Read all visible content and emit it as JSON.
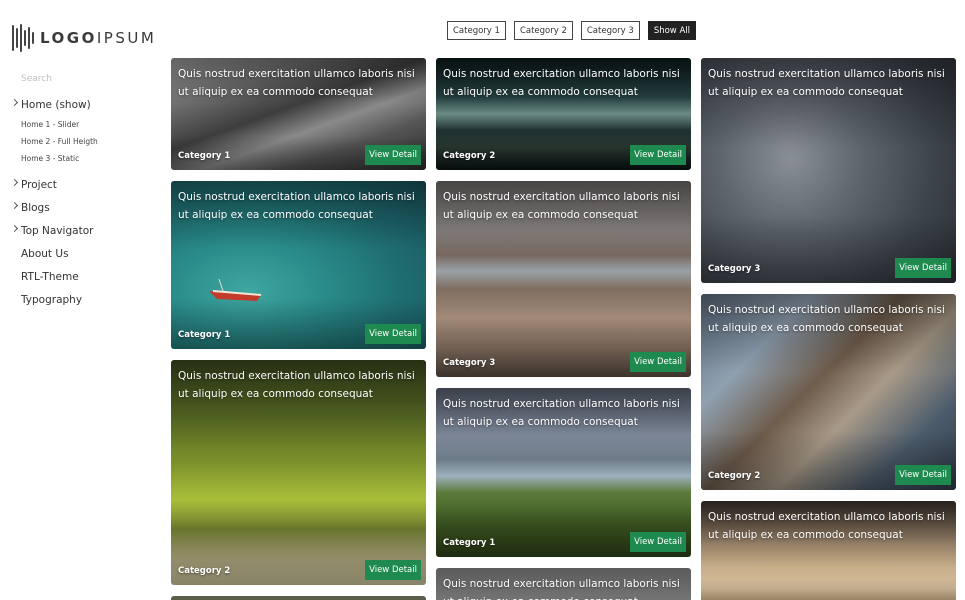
{
  "logo": {
    "bold": "LOGO",
    "light": "IPSUM"
  },
  "search": {
    "placeholder": "Search"
  },
  "nav": {
    "home": "Home (show)",
    "home1": "Home 1 - Slider",
    "home2": "Home 2 - Full Heigth",
    "home3": "Home 3 - Static",
    "project": "Project",
    "blogs": "Blogs",
    "topnav": "Top Navigator",
    "about": "About Us",
    "rtl": "RTL-Theme",
    "typography": "Typography"
  },
  "filters": [
    "Category 1",
    "Category 2",
    "Category 3",
    "Show All"
  ],
  "colors": {
    "accent": "#1e8a4f",
    "active_filter": "#222222"
  },
  "cards": [
    {
      "text": "Quis nostrud exercitation ullamco laboris nisi ut aliquip ex ea commodo consequat",
      "category": "Category 1",
      "button": "View Detail"
    },
    {
      "text": "Quis nostrud exercitation ullamco laboris nisi ut aliquip ex ea commodo consequat",
      "category": "Category 1",
      "button": "View Detail"
    },
    {
      "text": "Quis nostrud exercitation ullamco laboris nisi ut aliquip ex ea commodo consequat",
      "category": "Category 2",
      "button": "View Detail"
    },
    {
      "text": "Quis nostrud exercitation ullamco laboris nisi ut aliquip ex ea commodo consequat",
      "category": "Category 2",
      "button": "View Detail"
    },
    {
      "text": "Quis nostrud exercitation ullamco laboris nisi ut aliquip ex ea commodo consequat",
      "category": "Category 3",
      "button": "View Detail"
    },
    {
      "text": "Quis nostrud exercitation ullamco laboris nisi ut aliquip ex ea commodo consequat",
      "category": "Category 1",
      "button": "View Detail"
    },
    {
      "text": "Quis nostrud exercitation ullamco laboris nisi ut aliquip ex ea commodo consequat",
      "category": "",
      "button": ""
    },
    {
      "text": "Quis nostrud exercitation ullamco laboris nisi ut aliquip ex ea commodo consequat",
      "category": "Category 3",
      "button": "View Detail"
    },
    {
      "text": "Quis nostrud exercitation ullamco laboris nisi ut aliquip ex ea commodo consequat",
      "category": "Category 2",
      "button": "View Detail"
    },
    {
      "text": "Quis nostrud exercitation ullamco laboris nisi ut aliquip ex ea commodo consequat",
      "category": "",
      "button": ""
    }
  ]
}
